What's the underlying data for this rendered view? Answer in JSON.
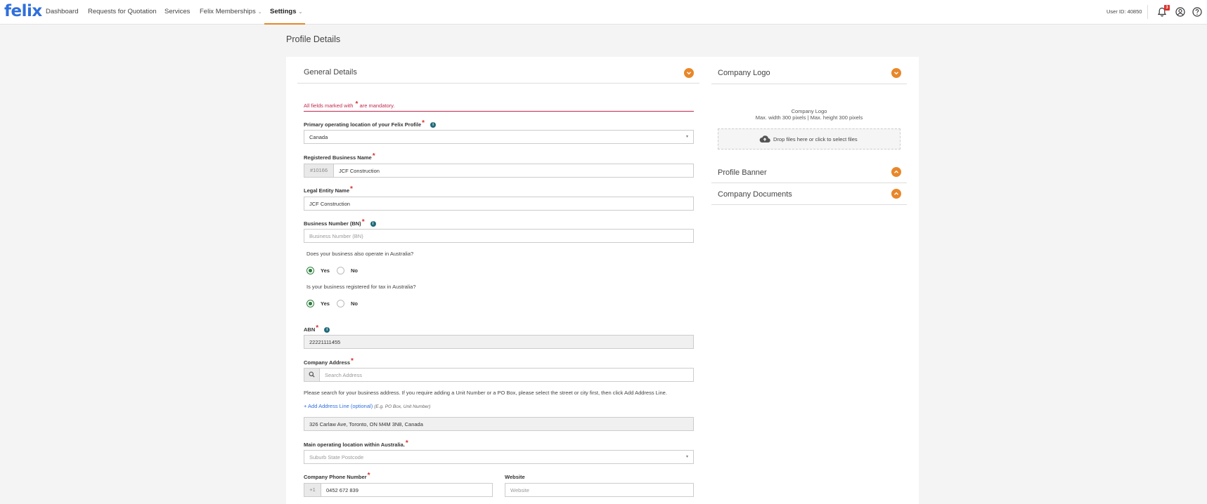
{
  "nav": {
    "logo": "felix",
    "items": [
      "Dashboard",
      "Requests for Quotation",
      "Services",
      "Felix Memberships",
      "Settings"
    ],
    "user_id": "User ID: 40850",
    "notification_count": "3"
  },
  "page": {
    "title": "Profile Details"
  },
  "general": {
    "heading": "General Details",
    "mandatory_note_pre": "All fields marked with",
    "mandatory_note_post": "are mandatory.",
    "primary_location": {
      "label": "Primary operating location of your Felix Profile",
      "value": "Canada"
    },
    "business_name": {
      "label": "Registered Business Name",
      "prefix": "#10166",
      "value": "JCF Construction"
    },
    "legal_entity": {
      "label": "Legal Entity Name",
      "value": "JCF Construction"
    },
    "bn": {
      "label": "Business Number (BN)",
      "placeholder": "Business Number (BN)"
    },
    "q_operate": {
      "question": "Does your business also operate in Australia?",
      "yes": "Yes",
      "no": "No",
      "selected": "Yes"
    },
    "q_tax": {
      "question": "Is your business registered for tax in Australia?",
      "yes": "Yes",
      "no": "No",
      "selected": "Yes"
    },
    "abn": {
      "label": "ABN",
      "value": "22221111455"
    },
    "address": {
      "label": "Company Address",
      "placeholder": "Search Address",
      "help": "Please search for your business address. If you require adding a Unit Number or a PO Box, please select the street or city first, then click Add Address Line.",
      "add_line": "+ Add Address Line (optional)",
      "add_line_eg": "(E.g. PO Box, Unit Number)",
      "value": "326 Carlaw Ave, Toronto, ON M4M 3N8, Canada"
    },
    "main_location": {
      "label": "Main operating location within Australia.",
      "placeholder": "Suburb State Postcode"
    },
    "phone": {
      "label": "Company Phone Number",
      "prefix": "+1",
      "value": "0452 672 839"
    },
    "website": {
      "label": "Website",
      "placeholder": "Website"
    }
  },
  "logo_section": {
    "heading": "Company Logo",
    "caption_1": "Company Logo",
    "caption_2": "Max. width 300 pixels | Max. height 300 pixels",
    "dropzone": "Drop files here or click to select files"
  },
  "banner": {
    "heading": "Profile Banner"
  },
  "documents": {
    "heading": "Company Documents"
  },
  "colors": {
    "brand": "#2f6fdc",
    "accent": "#e8872a",
    "required": "#d9302c",
    "radio": "#2f7d3e"
  },
  "icons": [
    "bell-icon",
    "user-circle-icon",
    "help-icon",
    "info-icon",
    "search-icon",
    "cloud-upload-icon",
    "chevron-down-icon",
    "chevron-up-icon"
  ]
}
